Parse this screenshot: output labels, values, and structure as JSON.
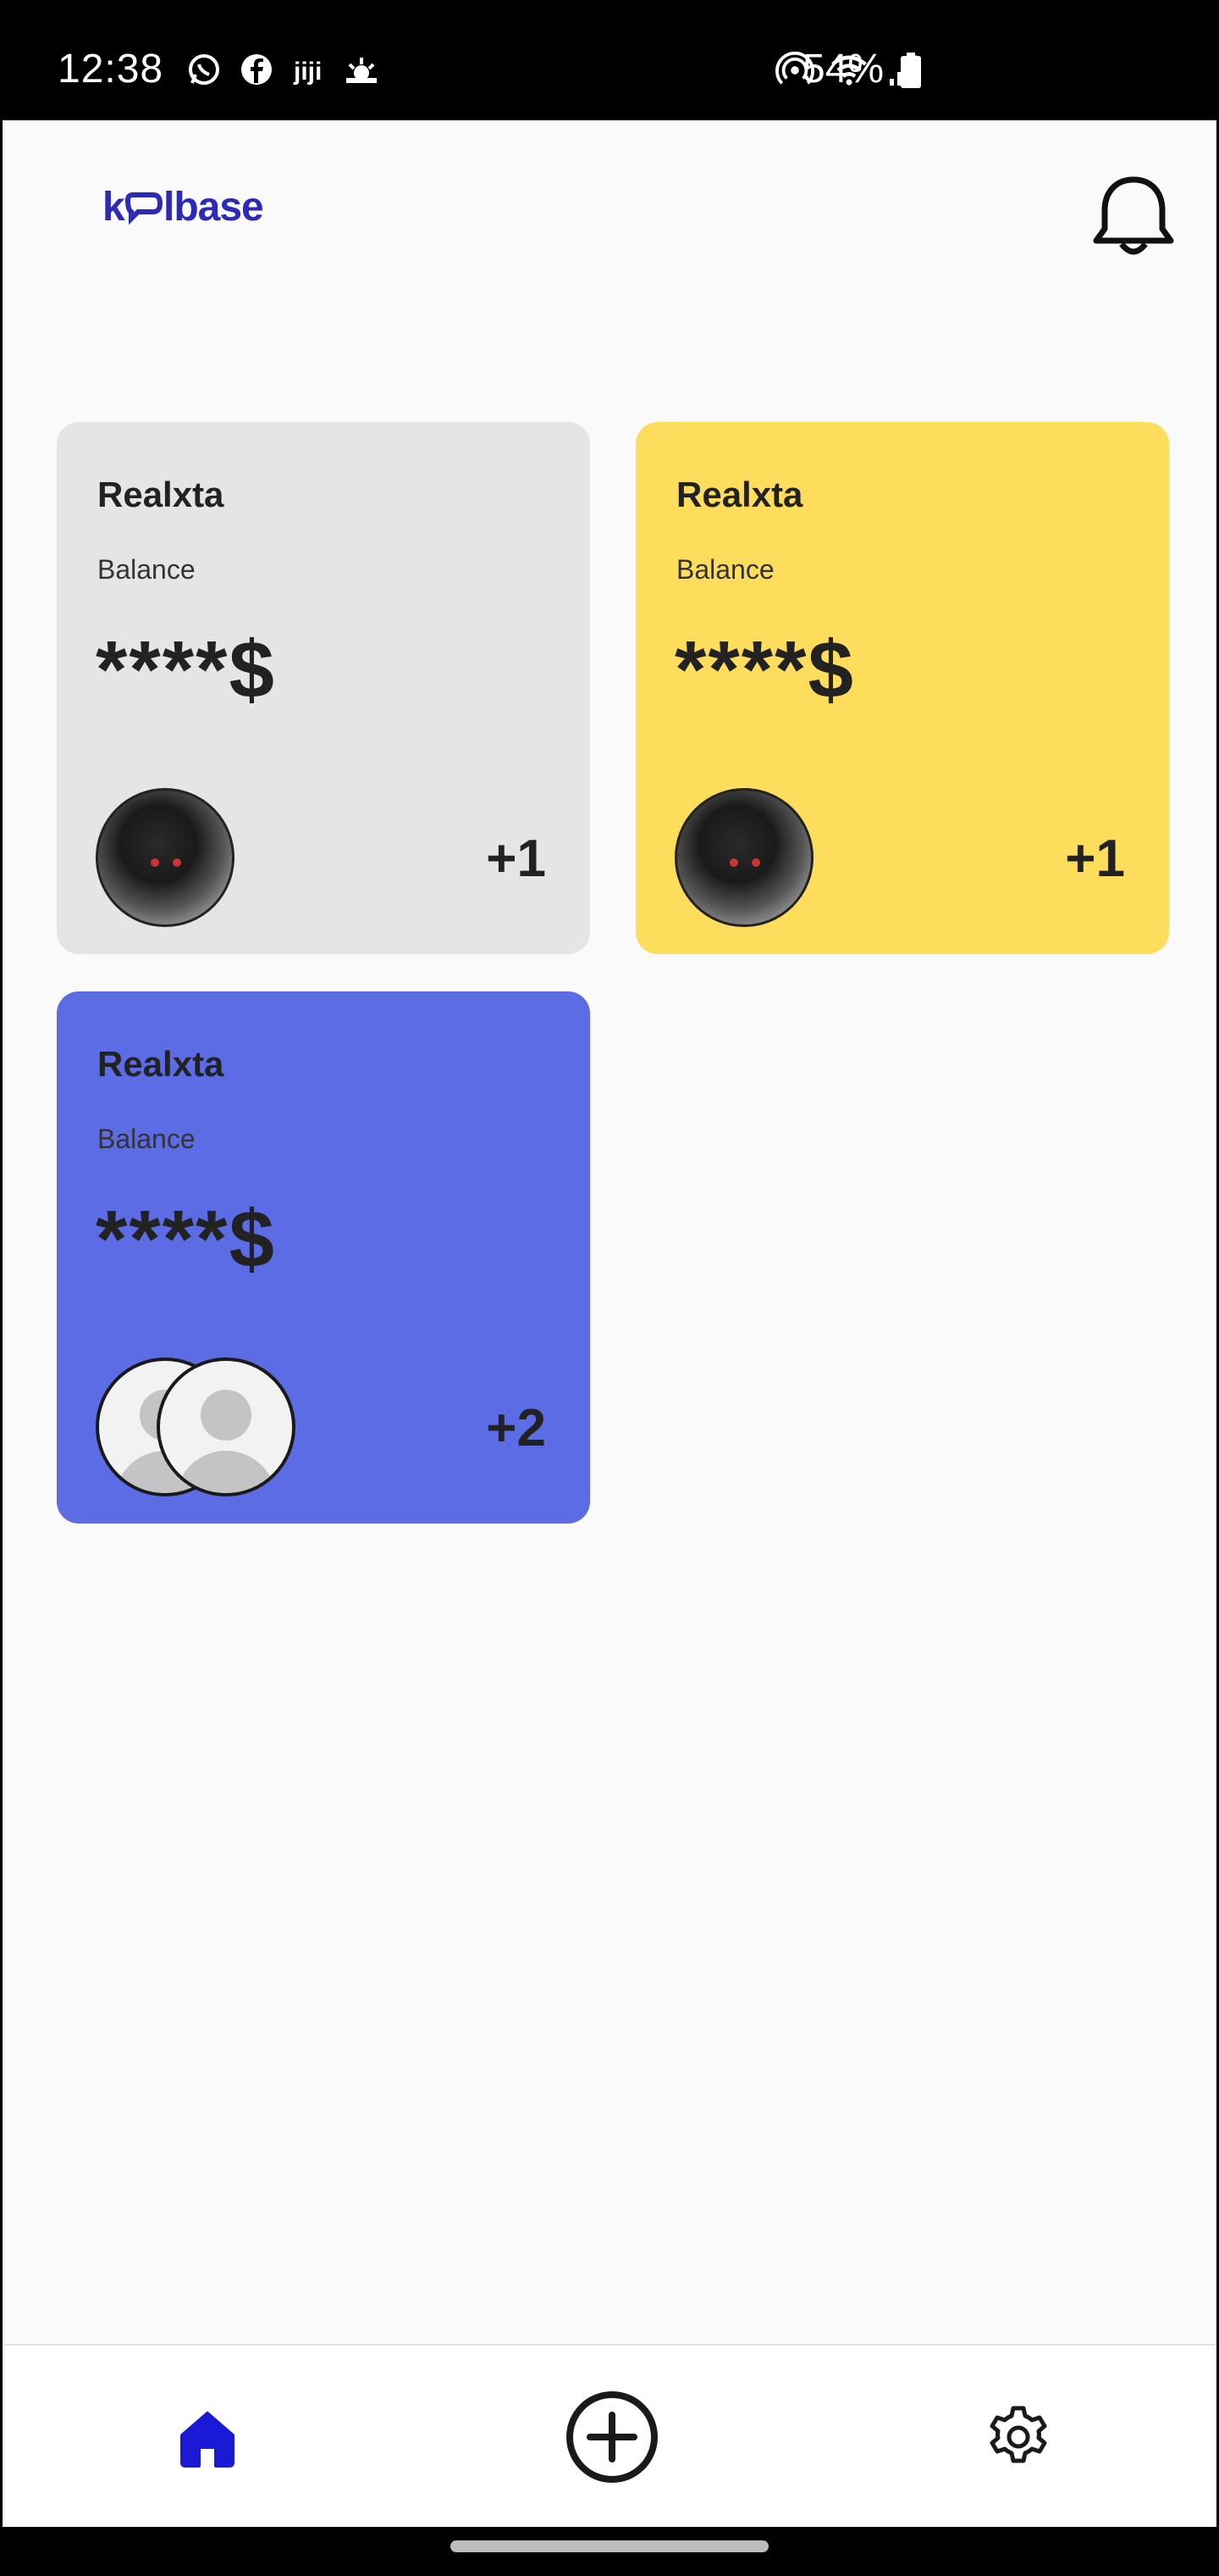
{
  "status_bar": {
    "time": "12:38",
    "battery": "54%",
    "left_icons": [
      "whatsapp-icon",
      "facebook-icon",
      "jiji-icon",
      "weather-icon"
    ],
    "right_icons": [
      "hotspot-icon",
      "wifi-icon",
      "signal-icon",
      "battery-icon"
    ]
  },
  "header": {
    "logo": "kolbase",
    "notification_icon": "bell-icon"
  },
  "cards": [
    {
      "name": "Realxta",
      "balance_label": "Balance",
      "balance_value": "****$",
      "count": "+1",
      "color": "#e5e5e5",
      "avatar": "photo"
    },
    {
      "name": "Realxta",
      "balance_label": "Balance",
      "balance_value": "****$",
      "count": "+1",
      "color": "#fedd5d",
      "avatar": "photo"
    },
    {
      "name": "Realxta",
      "balance_label": "Balance",
      "balance_value": "****$",
      "count": "+2",
      "color": "#5b6ce4",
      "avatar": "default-pair"
    }
  ],
  "bottom_nav": {
    "items": [
      {
        "name": "home",
        "icon": "home-icon",
        "active": true,
        "color": "#1a1ad6"
      },
      {
        "name": "add",
        "icon": "plus-circle-icon",
        "active": false
      },
      {
        "name": "settings",
        "icon": "gear-icon",
        "active": false
      }
    ]
  },
  "colors": {
    "brand": "#2d2ab8",
    "accent": "#1a1ad6"
  }
}
